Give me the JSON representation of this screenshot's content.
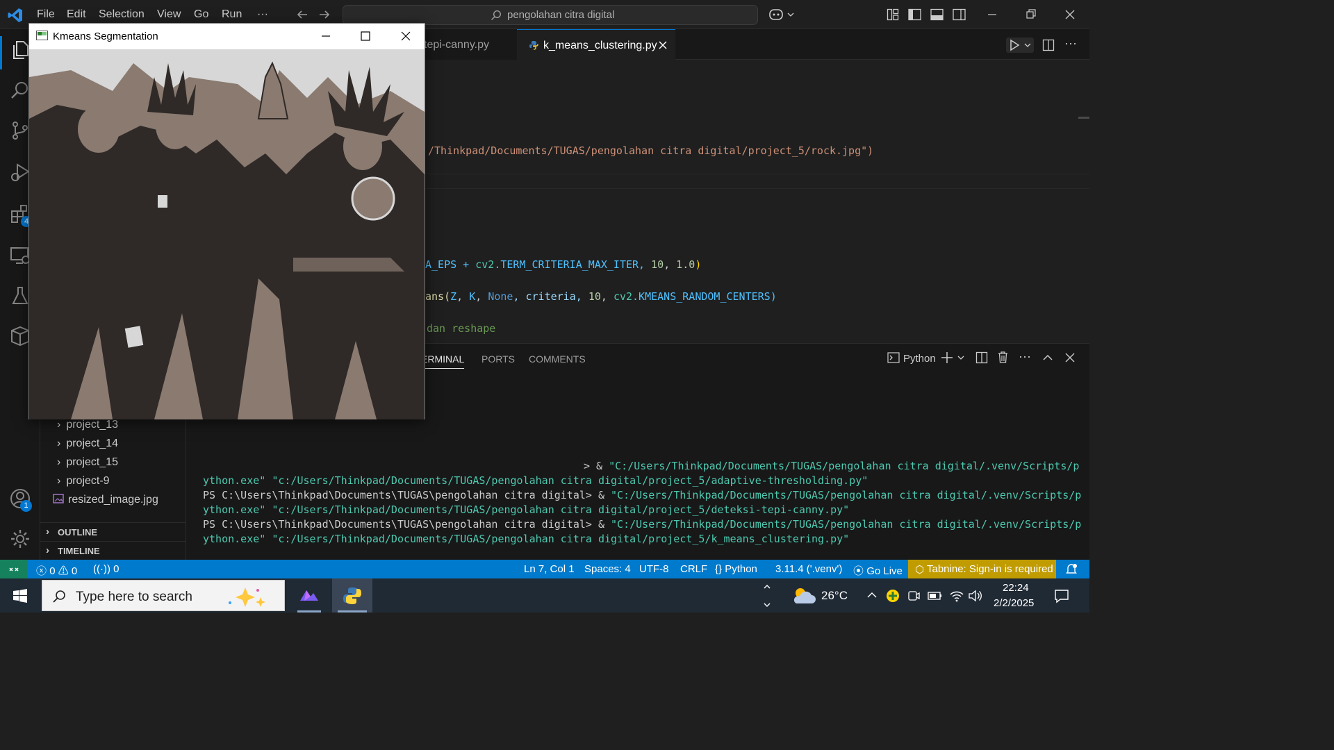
{
  "titlebar": {
    "menu": [
      "File",
      "Edit",
      "Selection",
      "View",
      "Go",
      "Run",
      "···"
    ],
    "search_text": "pengolahan citra digital"
  },
  "kmeans_window": {
    "title": "Kmeans Segmentation",
    "image_description_colors": {
      "light": "#d7d7d7",
      "mid": "#8a7a70",
      "dark": "#2f2a27"
    }
  },
  "tabs": [
    {
      "label": "tepi-canny.py",
      "active": false
    },
    {
      "label": "k_means_clustering.py",
      "active": true
    }
  ],
  "code": {
    "line_path": "/Thinkpad/Documents/TUGAS/pengolahan citra digital/project_5/rock.jpg\")",
    "line_criteria_a": "A_EPS + ",
    "line_criteria_b": "cv2",
    "line_criteria_c": ".TERM_CRITERIA_MAX_ITER, ",
    "line_criteria_d": "10",
    "line_criteria_e": ", ",
    "line_criteria_f": "1.0",
    "line_criteria_g": ")",
    "line_kmeans_a": "ans(",
    "line_kmeans_b": "Z",
    "line_kmeans_c": ", ",
    "line_kmeans_d": "K",
    "line_kmeans_e": ", ",
    "line_kmeans_f": "None",
    "line_kmeans_g": ", criteria, ",
    "line_kmeans_h": "10",
    "line_kmeans_i": ", ",
    "line_kmeans_j": "cv2",
    "line_kmeans_k": ".KMEANS_RANDOM_CENTERS)",
    "line_comment": "dan reshape"
  },
  "sidebar": {
    "items": [
      "project_13",
      "project_14",
      "project_15",
      "project-9",
      "resized_image.jpg"
    ],
    "outline": "OUTLINE",
    "timeline": "TIMELINE"
  },
  "panel": {
    "tabs": [
      "ERMINAL",
      "PORTS",
      "COMMENTS"
    ],
    "shell": "Python",
    "lines": [
      {
        "prompt": "",
        "cmd": "> & ",
        "str": "\"C:/Users/Thinkpad/Documents/TUGAS/pengolahan citra digital/.venv/Scripts/p"
      },
      {
        "prompt": "",
        "cmd": "",
        "str": "ython.exe\" \"c:/Users/Thinkpad/Documents/TUGAS/pengolahan citra digital/project_5/adaptive-thresholding.py\""
      },
      {
        "prompt": "PS C:\\Users\\Thinkpad\\Documents\\TUGAS\\pengolahan citra digital> ",
        "cmd": "& ",
        "str": "\"C:/Users/Thinkpad/Documents/TUGAS/pengolahan citra digital/.venv/Scripts/p"
      },
      {
        "prompt": "",
        "cmd": "",
        "str": "ython.exe\" \"c:/Users/Thinkpad/Documents/TUGAS/pengolahan citra digital/project_5/deteksi-tepi-canny.py\""
      },
      {
        "prompt": "PS C:\\Users\\Thinkpad\\Documents\\TUGAS\\pengolahan citra digital> ",
        "cmd": "& ",
        "str": "\"C:/Users/Thinkpad/Documents/TUGAS/pengolahan citra digital/.venv/Scripts/p"
      },
      {
        "prompt": "",
        "cmd": "",
        "str": "ython.exe\" \"c:/Users/Thinkpad/Documents/TUGAS/pengolahan citra digital/project_5/k_means_clustering.py\""
      }
    ]
  },
  "statusbar": {
    "errors": "0",
    "warnings": "0",
    "ports": "0",
    "position": "Ln 7, Col 1",
    "spaces": "Spaces: 4",
    "encoding": "UTF-8",
    "eol": "CRLF",
    "language": "Python",
    "interpreter": "3.11.4 ('.venv')",
    "golive": "Go Live",
    "tabnine": "Tabnine: Sign-in is required"
  },
  "activity": {
    "extensions_badge": "4",
    "accounts_badge": "1"
  },
  "taskbar": {
    "search_placeholder": "Type here to search",
    "weather": "26°C",
    "time": "22:24",
    "date": "2/2/2025"
  }
}
